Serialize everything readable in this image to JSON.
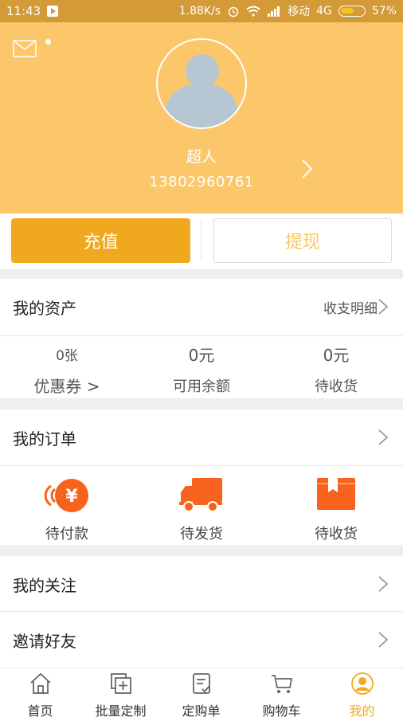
{
  "status_bar": {
    "time": "11:43",
    "speed": "1.88K/s",
    "carrier": "移动",
    "network": "4G",
    "battery": "57%"
  },
  "profile": {
    "nickname": "超人",
    "phone": "13802960761"
  },
  "actions": {
    "recharge_label": "充值",
    "withdraw_label": "提现"
  },
  "assets": {
    "title": "我的资产",
    "detail_link": "收支明细",
    "items": [
      {
        "value": "0张",
        "label": "优惠券 >"
      },
      {
        "value": "0元",
        "label": "可用余额"
      },
      {
        "value": "0元",
        "label": "待收货"
      }
    ]
  },
  "orders": {
    "title": "我的订单",
    "items": [
      {
        "label": "待付款",
        "icon": "yuan-coin-icon"
      },
      {
        "label": "待发货",
        "icon": "truck-icon"
      },
      {
        "label": "待收货",
        "icon": "package-icon"
      }
    ]
  },
  "menu": {
    "follow": "我的关注",
    "invite": "邀请好友"
  },
  "tabs": [
    {
      "label": "首页",
      "icon": "home-icon"
    },
    {
      "label": "批量定制",
      "icon": "batch-icon"
    },
    {
      "label": "定购单",
      "icon": "order-form-icon"
    },
    {
      "label": "购物车",
      "icon": "cart-icon"
    },
    {
      "label": "我的",
      "icon": "profile-icon",
      "active": true
    }
  ],
  "colors": {
    "header": "#fcc76a",
    "accent": "#f0a91e",
    "orange": "#f7631c"
  }
}
